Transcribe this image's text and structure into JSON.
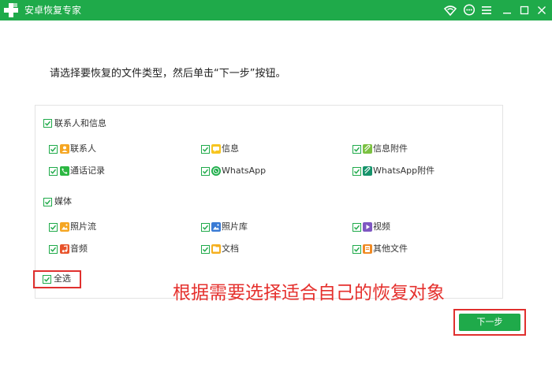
{
  "window": {
    "title": "安卓恢复专家",
    "controls": [
      "wifi-icon",
      "chat-icon",
      "menu-icon",
      "minimize-icon",
      "maximize-icon",
      "close-icon"
    ]
  },
  "instruction": "请选择要恢复的文件类型，然后单击“下一步”按钮。",
  "contacts_section": {
    "label": "联系人和信息",
    "checked": true,
    "items": [
      {
        "label": "联系人",
        "checked": true,
        "icon": "contacts-icon",
        "color": "#f5a623"
      },
      {
        "label": "信息",
        "checked": true,
        "icon": "message-icon",
        "color": "#f7c520"
      },
      {
        "label": "信息附件",
        "checked": true,
        "icon": "attachment-icon",
        "color": "#7cc142"
      },
      {
        "label": "通话记录",
        "checked": true,
        "icon": "call-log-icon",
        "color": "#2cb742"
      },
      {
        "label": "WhatsApp",
        "checked": true,
        "icon": "whatsapp-icon",
        "color": "#1fae4b"
      },
      {
        "label": "WhatsApp附件",
        "checked": true,
        "icon": "whatsapp-attachment-icon",
        "color": "#16936b"
      }
    ]
  },
  "media_section": {
    "label": "媒体",
    "checked": true,
    "items": [
      {
        "label": "照片流",
        "checked": true,
        "icon": "photo-stream-icon",
        "color": "#f5a623"
      },
      {
        "label": "照片库",
        "checked": true,
        "icon": "photo-library-icon",
        "color": "#3a7bd5"
      },
      {
        "label": "视频",
        "checked": true,
        "icon": "video-icon",
        "color": "#7e57c2"
      },
      {
        "label": "音频",
        "checked": true,
        "icon": "audio-icon",
        "color": "#e8532b"
      },
      {
        "label": "文档",
        "checked": true,
        "icon": "document-icon",
        "color": "#f5b020"
      },
      {
        "label": "其他文件",
        "checked": true,
        "icon": "other-files-icon",
        "color": "#f08a24"
      }
    ]
  },
  "select_all": {
    "label": "全选",
    "checked": true
  },
  "annotation": "根据需要选择适合自己的恢复对象",
  "next_button": "下一步",
  "colors": {
    "brand": "#1faa4a",
    "highlight": "#e0302e"
  }
}
